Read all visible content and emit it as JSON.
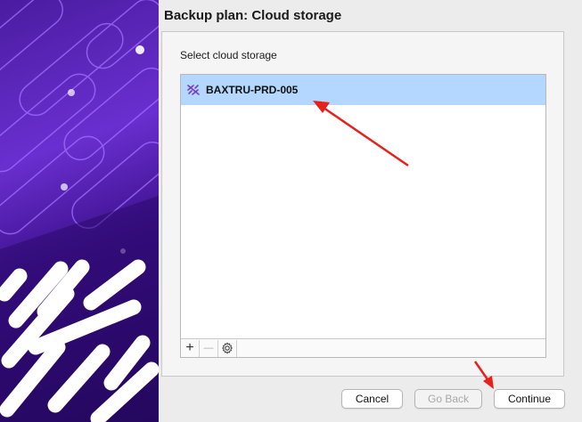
{
  "dialog": {
    "title": "Backup plan: Cloud storage",
    "section_label": "Select cloud storage"
  },
  "storage_list": {
    "items": [
      {
        "label": "BAXTRU-PRD-005",
        "icon": "cloud-storage-icon",
        "selected": true
      }
    ]
  },
  "list_toolbar": {
    "add_label": "+",
    "remove_label": "—",
    "settings_icon": "gear-icon"
  },
  "buttons": {
    "cancel": "Cancel",
    "go_back": "Go Back",
    "continue": "Continue"
  },
  "colors": {
    "selection": "#b3d7ff",
    "annotation_arrow": "#e8201c",
    "side_art_purple": "#6a2fd0"
  }
}
